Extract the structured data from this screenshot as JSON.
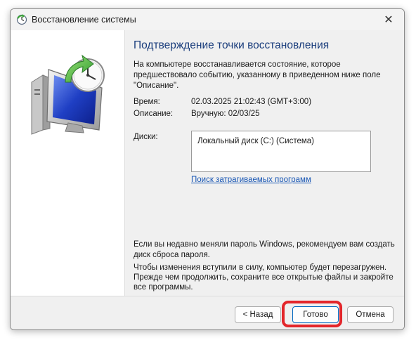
{
  "window": {
    "title": "Восстановление системы",
    "close_glyph": "✕"
  },
  "main": {
    "heading": "Подтверждение точки восстановления",
    "description": "На компьютере восстанавливается состояние, которое предшествовало событию, указанному в приведенном ниже поле \"Описание\".",
    "time_label": "Время:",
    "time_value": "02.03.2025 21:02:43 (GMT+3:00)",
    "desc_label": "Описание:",
    "desc_value": "Вручную: 02/03/25",
    "disks_label": "Диски:",
    "disks_value": "Локальный диск (C:) (Система)",
    "affected_link": "Поиск затрагиваемых программ",
    "password_note": "Если вы недавно меняли пароль Windows, рекомендуем вам создать диск сброса пароля.",
    "restart_note": "Чтобы изменения вступили в силу, компьютер будет перезагружен. Прежде чем продолжить, сохраните все открытые файлы и закройте все программы."
  },
  "footer": {
    "back_label": "< Назад",
    "finish_label": "Готово",
    "cancel_label": "Отмена"
  },
  "colors": {
    "heading": "#1a3d7c",
    "link": "#1856b4",
    "highlight": "#e3262b",
    "accent": "#0067c0"
  },
  "icons": {
    "title": "system-restore-icon",
    "illustration": "monitor-clock-restore-icon",
    "close": "close-icon"
  }
}
